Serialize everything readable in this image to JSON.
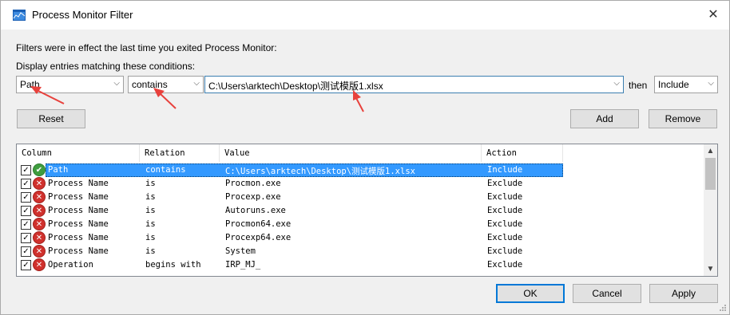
{
  "window": {
    "title": "Process Monitor Filter",
    "close_glyph": "✕"
  },
  "info_text": "Filters were in effect the last time you exited Process Monitor:",
  "conditions_label": "Display entries matching these conditions:",
  "filter_row": {
    "column_value": "Path",
    "relation_value": "contains",
    "value_text": "C:\\Users\\arktech\\Desktop\\测试模版1.xlsx",
    "then_label": "then",
    "action_value": "Include"
  },
  "buttons": {
    "reset": "Reset",
    "add": "Add",
    "remove": "Remove",
    "ok": "OK",
    "cancel": "Cancel",
    "apply": "Apply"
  },
  "table": {
    "headers": [
      "Column",
      "Relation",
      "Value",
      "Action"
    ],
    "rows": [
      {
        "checked": true,
        "type": "include",
        "column": "Path",
        "relation": "contains",
        "value": "C:\\Users\\arktech\\Desktop\\测试模版1.xlsx",
        "action": "Include"
      },
      {
        "checked": true,
        "type": "exclude",
        "column": "Process Name",
        "relation": "is",
        "value": "Procmon.exe",
        "action": "Exclude"
      },
      {
        "checked": true,
        "type": "exclude",
        "column": "Process Name",
        "relation": "is",
        "value": "Procexp.exe",
        "action": "Exclude"
      },
      {
        "checked": true,
        "type": "exclude",
        "column": "Process Name",
        "relation": "is",
        "value": "Autoruns.exe",
        "action": "Exclude"
      },
      {
        "checked": true,
        "type": "exclude",
        "column": "Process Name",
        "relation": "is",
        "value": "Procmon64.exe",
        "action": "Exclude"
      },
      {
        "checked": true,
        "type": "exclude",
        "column": "Process Name",
        "relation": "is",
        "value": "Procexp64.exe",
        "action": "Exclude"
      },
      {
        "checked": true,
        "type": "exclude",
        "column": "Process Name",
        "relation": "is",
        "value": "System",
        "action": "Exclude"
      },
      {
        "checked": true,
        "type": "exclude",
        "column": "Operation",
        "relation": "begins with",
        "value": "IRP_MJ_",
        "action": "Exclude"
      }
    ]
  },
  "icons": {
    "checkmark": "✓",
    "include_icon": "✔",
    "exclude_icon": "✕",
    "dropdown": "⌵",
    "scroll_up": "▲",
    "scroll_down": "▼"
  },
  "colors": {
    "selection": "#3399ff",
    "annotation_arrow": "#e8413c",
    "default_button_border": "#0078d7"
  }
}
